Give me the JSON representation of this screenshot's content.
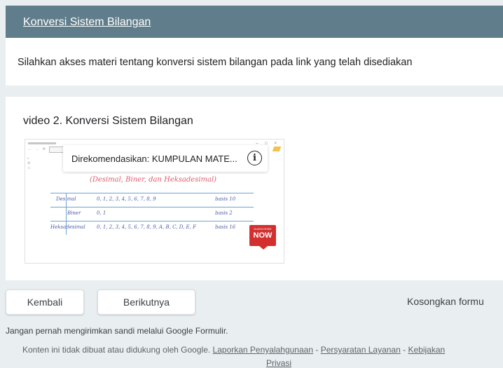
{
  "header": {
    "title": "Konversi Sistem Bilangan"
  },
  "description": {
    "text": "Silahkan akses materi tentang konversi sistem bilangan pada link yang telah disediakan"
  },
  "video_section": {
    "title": "video 2. Konversi Sistem Bilangan",
    "player": {
      "recommend_text": "Direkomendasikan: KUMPULAN MATE...",
      "info_icon": "i",
      "subtitle": "(Desimal, Biner, dan Heksadesimal)",
      "table": [
        {
          "name": "Desimal",
          "digits": "0, 1, 2, 3, 4, 5, 6, 7, 8, 9",
          "base": "basis 10"
        },
        {
          "name": "Biner",
          "digits": "0, 1",
          "base": "basis 2"
        },
        {
          "name": "Heksadesimal",
          "digits": "0, 1, 2, 3, 4, 5, 6, 7, 8, 9, A, B, C, D, E, F",
          "base": "basis 16"
        }
      ],
      "subscribe_small": "SUBSCRIBE",
      "subscribe_big": "NOW"
    }
  },
  "navigation": {
    "back_label": "Kembali",
    "next_label": "Berikutnya",
    "clear_label": "Kosongkan formu"
  },
  "note": "Jangan pernah mengirimkan sandi melalui Google Formulir.",
  "footer": {
    "prefix": "Konten ini tidak dibuat atau didukung oleh Google.",
    "report_link": "Laporkan Penyalahgunaan",
    "sep1": "-",
    "terms_link": "Persyaratan Layanan",
    "sep2": "-",
    "policy_link": "Kebijakan",
    "policy_cut": "Privasi"
  }
}
